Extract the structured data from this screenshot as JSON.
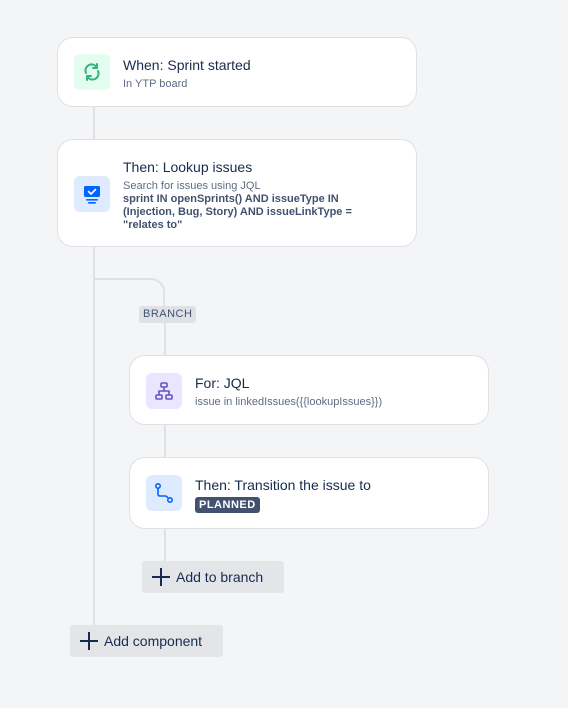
{
  "trigger": {
    "title": "When: Sprint started",
    "subtitle": "In YTP board",
    "icon": "cycle-icon",
    "color": "#36b37e",
    "bg": "#e3fcef"
  },
  "lookup": {
    "title": "Then: Lookup issues",
    "subtitle": "Search for issues using JQL",
    "jql_lines": [
      "sprint IN openSprints() AND issueType IN",
      "(Injection, Bug, Story) AND issueLinkType =",
      "\"relates to\""
    ],
    "icon": "monitor-check-icon",
    "color": "#0065ff",
    "bg": "#deebff"
  },
  "branch": {
    "label": "BRANCH",
    "for": {
      "title": "For: JQL",
      "subtitle": "issue in linkedIssues({{lookupIssues}})",
      "icon": "hierarchy-icon",
      "color": "#6554c0",
      "bg": "#eae6ff"
    },
    "transition": {
      "title": "Then: Transition the issue to",
      "status": "PLANNED",
      "icon": "transition-icon",
      "color": "#0065ff",
      "bg": "#deebff"
    },
    "add_label": "Add to branch"
  },
  "add_component_label": "Add component"
}
